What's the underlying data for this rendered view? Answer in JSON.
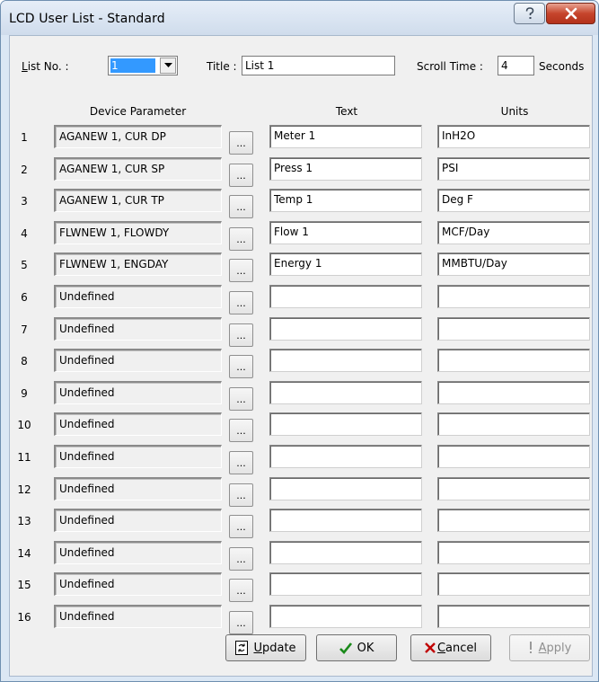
{
  "window": {
    "title": "LCD User List - Standard"
  },
  "icons": {
    "help": "help-question-icon",
    "close": "close-x-icon",
    "dropdown": "chevron-down-icon",
    "update": "update-arrows-icon",
    "ok": "checkmark-icon",
    "cancel": "x-mark-icon",
    "apply": "exclamation-icon"
  },
  "colors": {
    "ok_check": "#1a8a1a",
    "cancel_x": "#c00000",
    "selection": "#3399ff",
    "close_button": "#c6452c"
  },
  "top": {
    "list_no_label_first": "L",
    "list_no_label_rest": "ist No. :",
    "list_no_value": "1",
    "title_label": "Title :",
    "title_value": "List 1",
    "scroll_label": "Scroll Time :",
    "scroll_value": "4",
    "seconds_label": "Seconds"
  },
  "columns": {
    "device": "Device Parameter",
    "text": "Text",
    "units": "Units"
  },
  "browse_label": "...",
  "rows": [
    {
      "num": "1",
      "device": "AGANEW 1, CUR DP",
      "text": "Meter 1",
      "units": "InH2O"
    },
    {
      "num": "2",
      "device": "AGANEW 1, CUR SP",
      "text": "Press 1",
      "units": "PSI"
    },
    {
      "num": "3",
      "device": "AGANEW 1, CUR TP",
      "text": "Temp 1",
      "units": "Deg F"
    },
    {
      "num": "4",
      "device": "FLWNEW 1, FLOWDY",
      "text": "Flow 1",
      "units": "MCF/Day"
    },
    {
      "num": "5",
      "device": "FLWNEW 1, ENGDAY",
      "text": "Energy 1",
      "units": "MMBTU/Day"
    },
    {
      "num": "6",
      "device": "Undefined",
      "text": "",
      "units": ""
    },
    {
      "num": "7",
      "device": "Undefined",
      "text": "",
      "units": ""
    },
    {
      "num": "8",
      "device": "Undefined",
      "text": "",
      "units": ""
    },
    {
      "num": "9",
      "device": "Undefined",
      "text": "",
      "units": ""
    },
    {
      "num": "10",
      "device": "Undefined",
      "text": "",
      "units": ""
    },
    {
      "num": "11",
      "device": "Undefined",
      "text": "",
      "units": ""
    },
    {
      "num": "12",
      "device": "Undefined",
      "text": "",
      "units": ""
    },
    {
      "num": "13",
      "device": "Undefined",
      "text": "",
      "units": ""
    },
    {
      "num": "14",
      "device": "Undefined",
      "text": "",
      "units": ""
    },
    {
      "num": "15",
      "device": "Undefined",
      "text": "",
      "units": ""
    },
    {
      "num": "16",
      "device": "Undefined",
      "text": "",
      "units": ""
    }
  ],
  "buttons": {
    "update_first": "U",
    "update_rest": "pdate",
    "ok": "OK",
    "cancel_first": "C",
    "cancel_rest": "ancel",
    "apply_first": "A",
    "apply_rest": "pply"
  }
}
